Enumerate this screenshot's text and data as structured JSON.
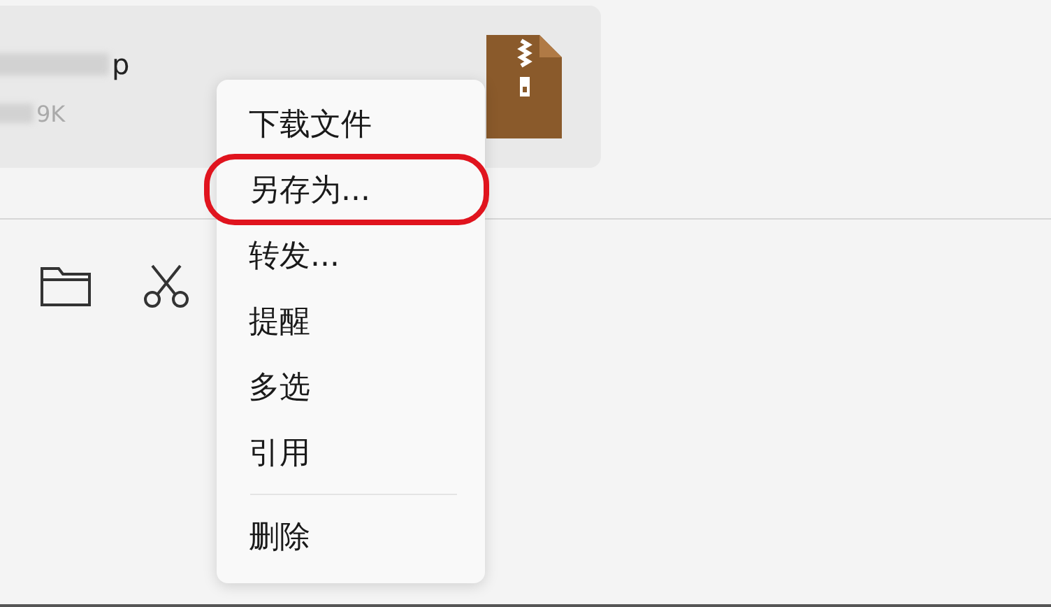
{
  "file_card": {
    "name_visible": "p",
    "size_visible": "9K"
  },
  "toolbar": [
    {
      "kind": "folder"
    },
    {
      "kind": "scissors"
    }
  ],
  "context_menu": {
    "items": [
      {
        "label": "下载文件",
        "divider_before": false,
        "circled": false
      },
      {
        "label": "另存为...",
        "divider_before": false,
        "circled": true
      },
      {
        "label": "转发...",
        "divider_before": false,
        "circled": false
      },
      {
        "label": "提醒",
        "divider_before": false,
        "circled": false
      },
      {
        "label": "多选",
        "divider_before": false,
        "circled": false
      },
      {
        "label": "引用",
        "divider_before": false,
        "circled": false
      },
      {
        "label": "删除",
        "divider_before": true,
        "circled": false
      }
    ]
  }
}
